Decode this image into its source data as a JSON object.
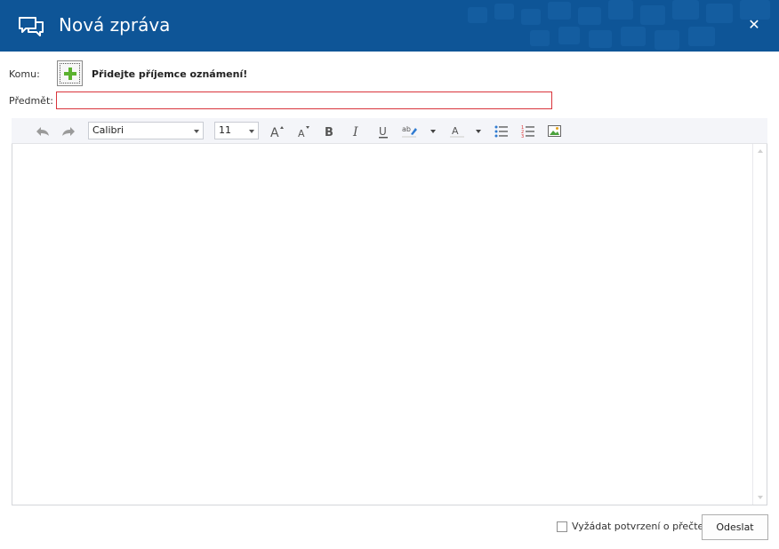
{
  "window": {
    "title": "Nová zpráva",
    "close_label": "✕",
    "header_color": "#0e5597"
  },
  "form": {
    "to_label": "Komu:",
    "add_recipient_text": "Přidejte příjemce oznámení!",
    "subject_label": "Předmět:",
    "subject_value": "",
    "subject_border_color": "#d9343b"
  },
  "toolbar": {
    "font": "Calibri",
    "size": "11",
    "icons": [
      "undo-icon",
      "redo-icon",
      "grow-font-icon",
      "shrink-font-icon",
      "bold-icon",
      "italic-icon",
      "underline-icon",
      "highlight-icon",
      "font-color-icon",
      "bullet-list-icon",
      "numbered-list-icon",
      "insert-image-icon"
    ]
  },
  "editor": {
    "content": ""
  },
  "footer": {
    "read_receipt_label": "Vyžádat potvrzení o přečtení",
    "read_receipt_checked": false,
    "send_label": "Odeslat"
  }
}
